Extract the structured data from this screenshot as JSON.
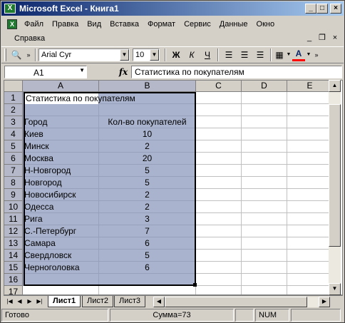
{
  "window": {
    "title": "Microsoft Excel - Книга1",
    "app_icon_letter": "X",
    "minimize": "_",
    "maximize": "□",
    "close": "×"
  },
  "menu": {
    "items": [
      "Файл",
      "Правка",
      "Вид",
      "Вставка",
      "Формат",
      "Сервис",
      "Данные",
      "Окно"
    ],
    "help": "Справка",
    "doc_min": "_",
    "doc_restore": "❐",
    "doc_close": "×"
  },
  "toolbar": {
    "font_name": "Arial Cyr",
    "font_size": "10",
    "bold": "Ж",
    "italic": "К",
    "underline": "Ч",
    "font_color": "#ff0000"
  },
  "formula_bar": {
    "name_box": "A1",
    "fx": "fx",
    "content": "Статистика по покупателям"
  },
  "columns": [
    "A",
    "B",
    "C",
    "D",
    "E"
  ],
  "rows": [
    "1",
    "2",
    "3",
    "4",
    "5",
    "6",
    "7",
    "8",
    "9",
    "10",
    "11",
    "12",
    "13",
    "14",
    "15",
    "16",
    "17"
  ],
  "cells": {
    "title": "Статистика по покупателям",
    "header_city": "Город",
    "header_count": "Кол-во покупателей",
    "data": [
      {
        "city": "Киев",
        "count": "10"
      },
      {
        "city": "Минск",
        "count": "2"
      },
      {
        "city": "Москва",
        "count": "20"
      },
      {
        "city": "Н-Новгород",
        "count": "5"
      },
      {
        "city": "Новгород",
        "count": "5"
      },
      {
        "city": "Новосибирск",
        "count": "2"
      },
      {
        "city": "Одесса",
        "count": "2"
      },
      {
        "city": "Рига",
        "count": "3"
      },
      {
        "city": "С.-Петербург",
        "count": "7"
      },
      {
        "city": "Самара",
        "count": "6"
      },
      {
        "city": "Свердловск",
        "count": "5"
      },
      {
        "city": "Черноголовка",
        "count": "6"
      }
    ]
  },
  "sheets": [
    "Лист1",
    "Лист2",
    "Лист3"
  ],
  "active_sheet": "Лист1",
  "status": {
    "mode": "Готово",
    "sum": "Сумма=73",
    "num": "NUM"
  },
  "colors": {
    "selection": "#a9b3cd",
    "title_bar": "#0a246a"
  }
}
